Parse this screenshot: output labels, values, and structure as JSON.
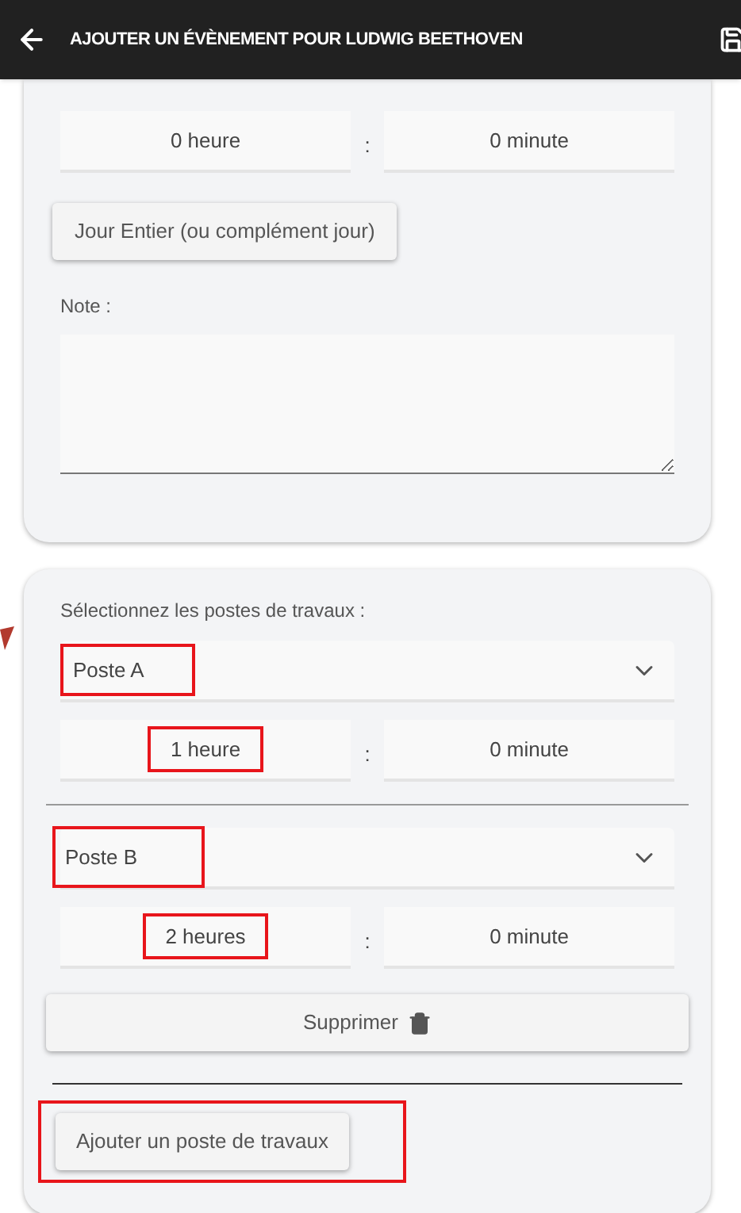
{
  "header": {
    "title": "AJOUTER UN ÉVÈNEMENT POUR LUDWIG BEETHOVEN"
  },
  "duration": {
    "hours": "0 heure",
    "separator": ":",
    "minutes": "0 minute"
  },
  "full_day_button": "Jour Entier (ou complément jour)",
  "note": {
    "label": "Note :"
  },
  "workstations": {
    "label": "Sélectionnez les postes de travaux :",
    "items": [
      {
        "post": "Poste A",
        "post_highlighted": true,
        "hours": "1 heure",
        "hours_highlighted": true,
        "separator": ":",
        "minutes": "0 minute"
      },
      {
        "post": "Poste B",
        "post_highlighted": true,
        "hours": "2 heures",
        "hours_highlighted": true,
        "separator": ":",
        "minutes": "0 minute"
      }
    ],
    "delete_button": "Supprimer",
    "add_button": "Ajouter un poste de travaux",
    "add_highlighted": true
  }
}
